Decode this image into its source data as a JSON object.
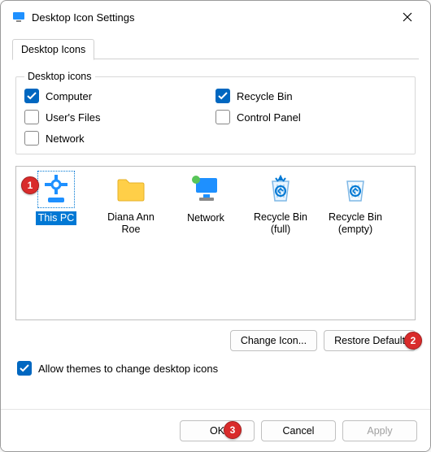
{
  "window": {
    "title": "Desktop Icon Settings"
  },
  "tabs": {
    "desktop_icons": "Desktop Icons"
  },
  "group": {
    "legend": "Desktop icons",
    "computer": "Computer",
    "recycle_bin": "Recycle Bin",
    "users_files": "User's Files",
    "control_panel": "Control Panel",
    "network": "Network",
    "checked": {
      "computer": true,
      "recycle_bin": true,
      "users_files": false,
      "control_panel": false,
      "network": false
    }
  },
  "preview": {
    "items": [
      {
        "label": "This PC",
        "selected": true,
        "icon": "this-pc"
      },
      {
        "label": "Diana Ann Roe",
        "selected": false,
        "icon": "folder"
      },
      {
        "label": "Network",
        "selected": false,
        "icon": "network"
      },
      {
        "label": "Recycle Bin (full)",
        "selected": false,
        "icon": "recycle-full"
      },
      {
        "label": "Recycle Bin (empty)",
        "selected": false,
        "icon": "recycle-empty"
      }
    ]
  },
  "buttons": {
    "change_icon": "Change Icon...",
    "restore_default": "Restore Default",
    "ok": "OK",
    "cancel": "Cancel",
    "apply": "Apply"
  },
  "allow_themes": "Allow themes to change desktop icons",
  "allow_themes_checked": true,
  "badges": {
    "b1": "1",
    "b2": "2",
    "b3": "3"
  }
}
